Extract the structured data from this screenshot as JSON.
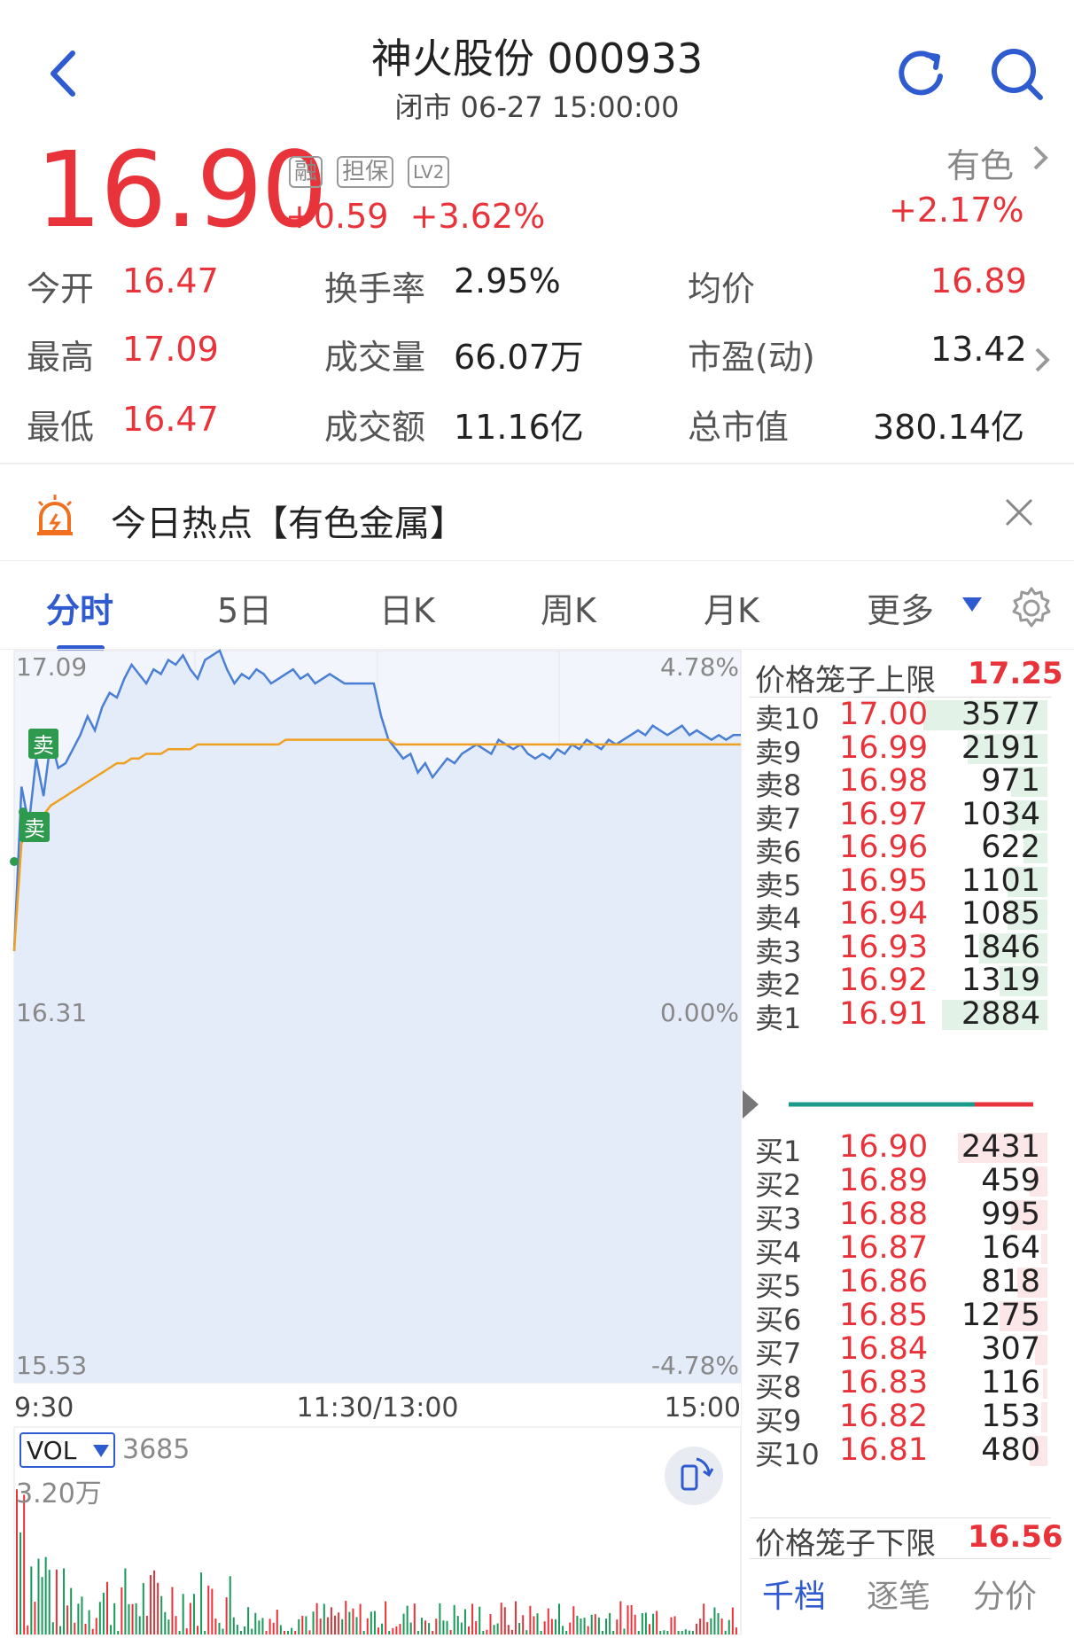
{
  "header": {
    "title": "神火股份 000933",
    "subtitle": "闭市 06-27 15:00:00"
  },
  "quote": {
    "price": "16.90",
    "change": "+0.59",
    "change_pct": "+3.62%",
    "tags": [
      "融",
      "担保",
      "LV2"
    ],
    "sector_name": "有色",
    "sector_change": "+2.17%"
  },
  "stats": {
    "open_label": "今开",
    "open": "16.47",
    "high_label": "最高",
    "high": "17.09",
    "low_label": "最低",
    "low": "16.47",
    "turnover_label": "换手率",
    "turnover": "2.95%",
    "volume_label": "成交量",
    "volume": "66.07万",
    "amount_label": "成交额",
    "amount": "11.16亿",
    "avg_label": "均价",
    "avg": "16.89",
    "pe_label": "市盈(动)",
    "pe": "13.42",
    "mcap_label": "总市值",
    "mcap": "380.14亿"
  },
  "hot": {
    "text": "今日热点【有色金属】"
  },
  "tabs": [
    "分时",
    "5日",
    "日K",
    "周K",
    "月K",
    "更多"
  ],
  "chart_data": {
    "type": "line",
    "axis_left": [
      "17.09",
      "16.31",
      "15.53"
    ],
    "axis_right": [
      "4.78%",
      "0.00%",
      "-4.78%"
    ],
    "time_labels": [
      "9:30",
      "11:30/13:00",
      "15:00"
    ],
    "ylim": [
      15.53,
      17.09
    ],
    "badges": [
      "卖",
      "卖"
    ],
    "series": [
      {
        "values": [
          16.45,
          16.8,
          16.72,
          16.86,
          16.78,
          16.9,
          16.84,
          16.85,
          16.88,
          16.91,
          16.95,
          16.92,
          16.97,
          17.0,
          16.99,
          17.03,
          17.06,
          17.04,
          17.02,
          17.05,
          17.04,
          17.07,
          17.06,
          17.08,
          17.05,
          17.03,
          17.07,
          17.08,
          17.09,
          17.05,
          17.02,
          17.04,
          17.03,
          17.05,
          17.04,
          17.02,
          17.03,
          17.04,
          17.05,
          17.03,
          17.04,
          17.02,
          17.03,
          17.04,
          17.03,
          17.02,
          17.02,
          17.02,
          17.02,
          17.02,
          16.95,
          16.9,
          16.88,
          16.86,
          16.87,
          16.83,
          16.85,
          16.82,
          16.84,
          16.86,
          16.85,
          16.87,
          16.88,
          16.89,
          16.88,
          16.87,
          16.9,
          16.89,
          16.88,
          16.89,
          16.87,
          16.86,
          16.87,
          16.86,
          16.88,
          16.87,
          16.89,
          16.88,
          16.9,
          16.89,
          16.88,
          16.9,
          16.89,
          16.9,
          16.91,
          16.92,
          16.91,
          16.93,
          16.92,
          16.91,
          16.92,
          16.93,
          16.91,
          16.92,
          16.91,
          16.9,
          16.91,
          16.9,
          16.91,
          16.91
        ]
      },
      {
        "values": [
          16.45,
          16.68,
          16.7,
          16.72,
          16.74,
          16.76,
          16.77,
          16.78,
          16.79,
          16.8,
          16.81,
          16.82,
          16.83,
          16.84,
          16.85,
          16.85,
          16.86,
          16.86,
          16.87,
          16.87,
          16.87,
          16.88,
          16.88,
          16.88,
          16.88,
          16.89,
          16.89,
          16.89,
          16.89,
          16.89,
          16.89,
          16.89,
          16.89,
          16.89,
          16.89,
          16.89,
          16.89,
          16.9,
          16.9,
          16.9,
          16.9,
          16.9,
          16.9,
          16.9,
          16.9,
          16.9,
          16.9,
          16.9,
          16.9,
          16.9,
          16.9,
          16.9,
          16.89,
          16.89,
          16.89,
          16.89,
          16.89,
          16.89,
          16.89,
          16.89,
          16.89,
          16.89,
          16.89,
          16.89,
          16.89,
          16.89,
          16.89,
          16.89,
          16.89,
          16.89,
          16.89,
          16.89,
          16.89,
          16.89,
          16.89,
          16.89,
          16.89,
          16.89,
          16.89,
          16.89,
          16.89,
          16.89,
          16.89,
          16.89,
          16.89,
          16.89,
          16.89,
          16.89,
          16.89,
          16.89,
          16.89,
          16.89,
          16.89,
          16.89,
          16.89,
          16.89,
          16.89,
          16.89,
          16.89,
          16.89
        ]
      }
    ]
  },
  "volume": {
    "selector": "VOL",
    "value": "3685",
    "max_label": "3.20万"
  },
  "orderbook": {
    "upper_limit_label": "价格笼子上限",
    "upper_limit": "17.25",
    "lower_limit_label": "价格笼子下限",
    "lower_limit": "16.56",
    "asks": [
      {
        "label": "卖10",
        "price": "17.00",
        "qty": "3577",
        "fill": 0.62
      },
      {
        "label": "卖9",
        "price": "16.99",
        "qty": "2191",
        "fill": 0.4
      },
      {
        "label": "卖8",
        "price": "16.98",
        "qty": "971",
        "fill": 0.18
      },
      {
        "label": "卖7",
        "price": "16.97",
        "qty": "1034",
        "fill": 0.19
      },
      {
        "label": "卖6",
        "price": "16.96",
        "qty": "622",
        "fill": 0.12
      },
      {
        "label": "卖5",
        "price": "16.95",
        "qty": "1101",
        "fill": 0.2
      },
      {
        "label": "卖4",
        "price": "16.94",
        "qty": "1085",
        "fill": 0.2
      },
      {
        "label": "卖3",
        "price": "16.93",
        "qty": "1846",
        "fill": 0.34
      },
      {
        "label": "卖2",
        "price": "16.92",
        "qty": "1319",
        "fill": 0.24
      },
      {
        "label": "卖1",
        "price": "16.91",
        "qty": "2884",
        "fill": 0.53
      }
    ],
    "bids": [
      {
        "label": "买1",
        "price": "16.90",
        "qty": "2431",
        "fill": 0.45
      },
      {
        "label": "买2",
        "price": "16.89",
        "qty": "459",
        "fill": 0.09
      },
      {
        "label": "买3",
        "price": "16.88",
        "qty": "995",
        "fill": 0.18
      },
      {
        "label": "买4",
        "price": "16.87",
        "qty": "164",
        "fill": 0.03
      },
      {
        "label": "买5",
        "price": "16.86",
        "qty": "818",
        "fill": 0.15
      },
      {
        "label": "买6",
        "price": "16.85",
        "qty": "1275",
        "fill": 0.24
      },
      {
        "label": "买7",
        "price": "16.84",
        "qty": "307",
        "fill": 0.06
      },
      {
        "label": "买8",
        "price": "16.83",
        "qty": "116",
        "fill": 0.02
      },
      {
        "label": "买9",
        "price": "16.82",
        "qty": "153",
        "fill": 0.03
      },
      {
        "label": "买10",
        "price": "16.81",
        "qty": "480",
        "fill": 0.09
      }
    ]
  },
  "bottom_tabs": [
    "千档",
    "逐笔",
    "分价"
  ],
  "colors": {
    "up": "#e8333a",
    "down": "#1a9a5a",
    "accent": "#2f5bd0",
    "price_line": "#4a7fd6",
    "avg_line": "#f0a020"
  }
}
